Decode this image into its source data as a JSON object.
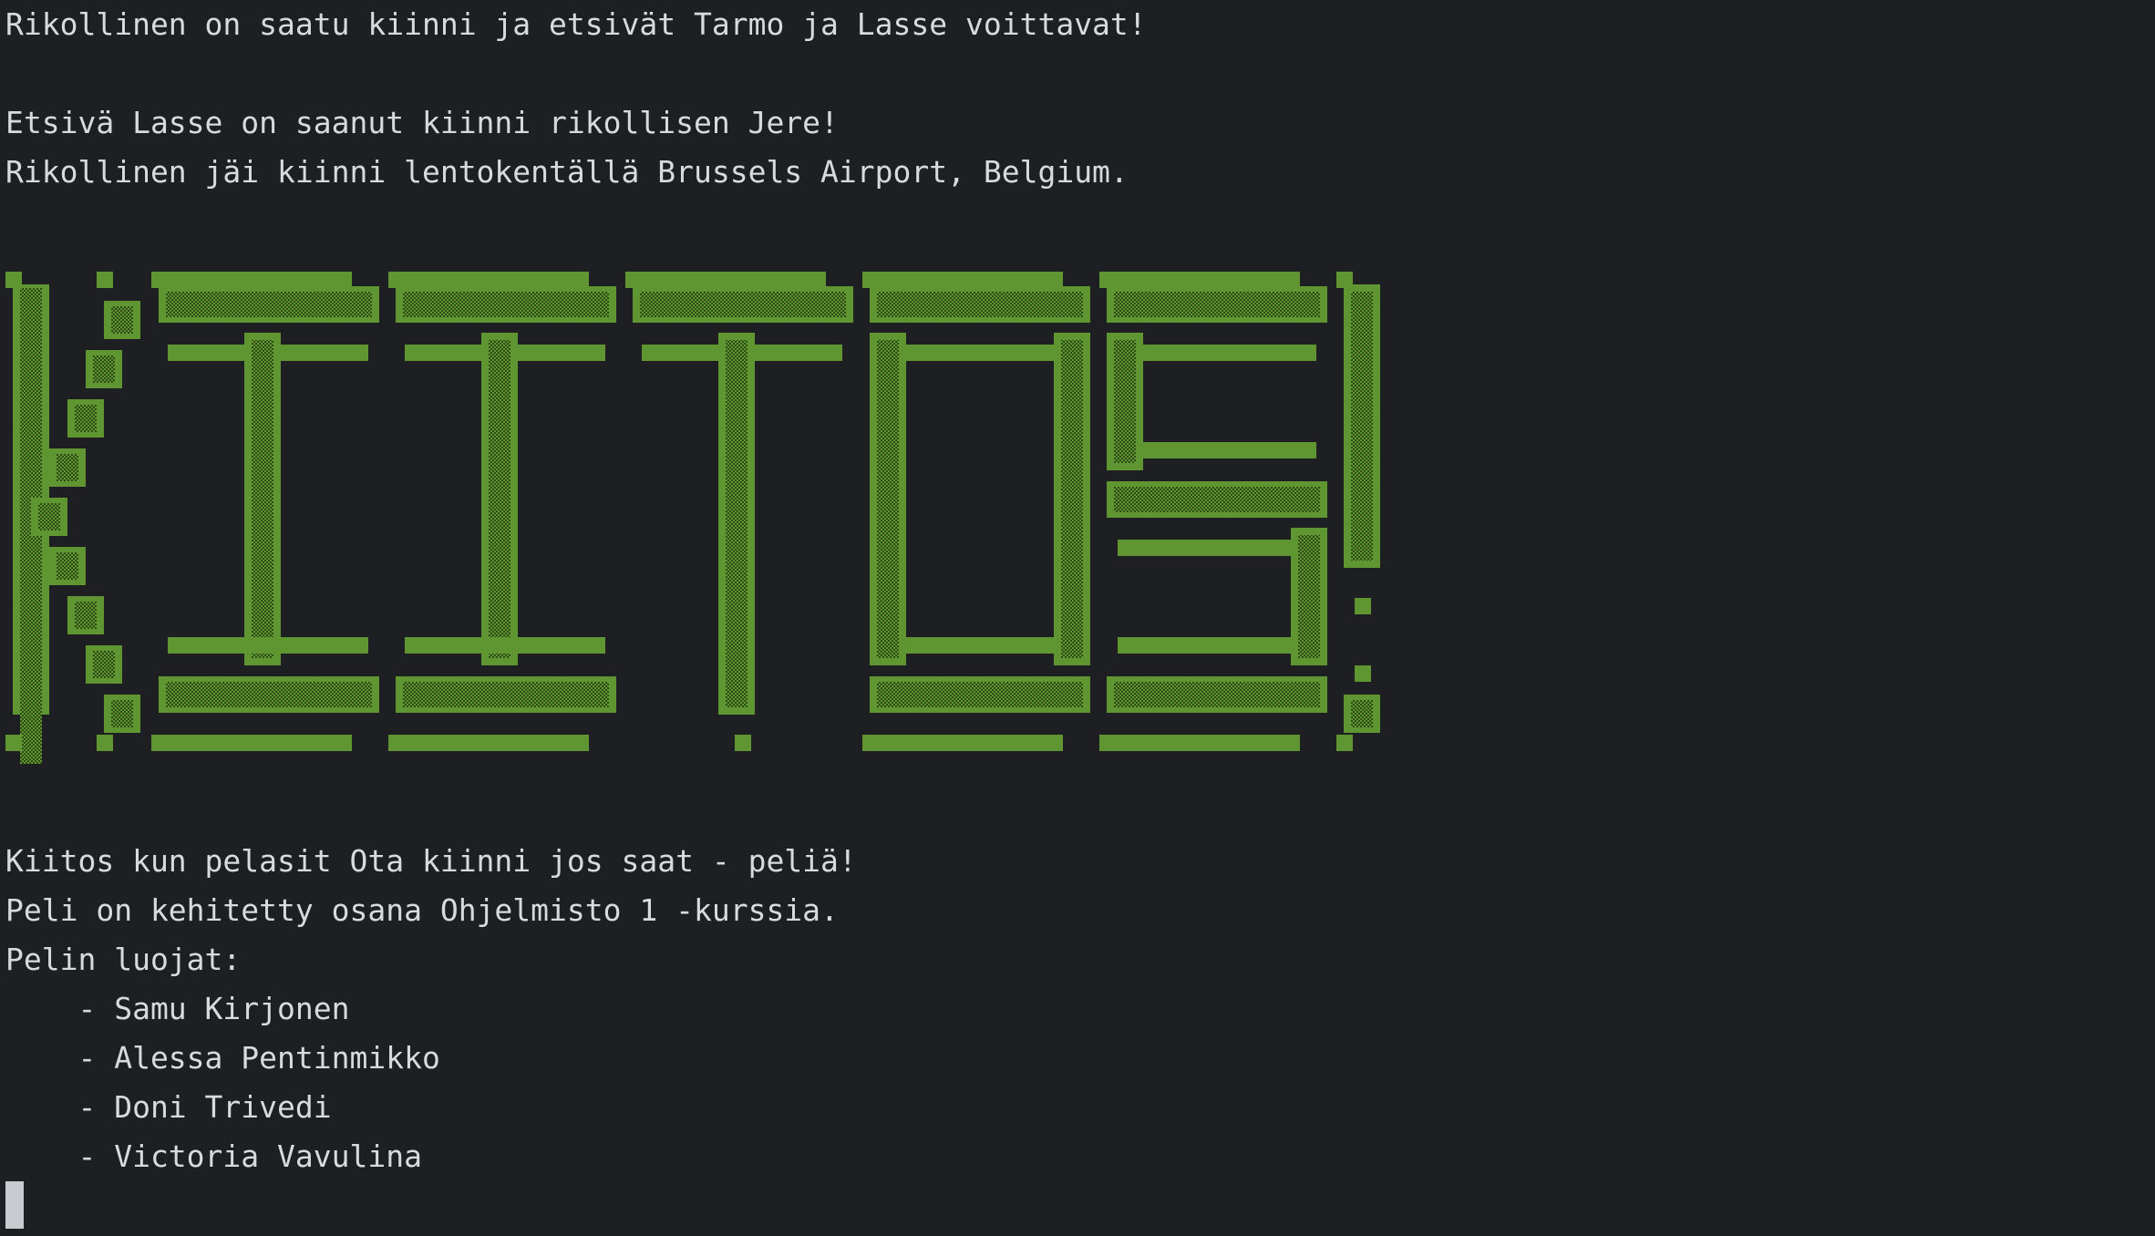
{
  "terminal": {
    "lines": [
      "Rikollinen on saatu kiinni ja etsivät Tarmo ja Lasse voittavat!",
      "",
      "Etsivä Lasse on saanut kiinni rikollisen Jere!",
      "Rikollinen jäi kiinni lentokentällä Brussels Airport, Belgium.",
      "",
      "",
      "",
      "",
      "",
      "",
      "",
      "",
      "",
      "",
      "",
      "",
      "",
      "Kiitos kun pelasit Ota kiinni jos saat - peliä!",
      "Peli on kehitetty osana Ohjelmisto 1 -kurssia.",
      "Pelin luojat:",
      "    - Samu Kirjonen",
      "    - Alessa Pentinmikko",
      "    - Doni Trivedi",
      "    - Victoria Vavulina"
    ],
    "banner": {
      "word": "KIITOS!",
      "color": "#5f9632",
      "shade_color": "#40691f"
    },
    "background": "#1e1f22",
    "text_color": "#d9dadd"
  }
}
